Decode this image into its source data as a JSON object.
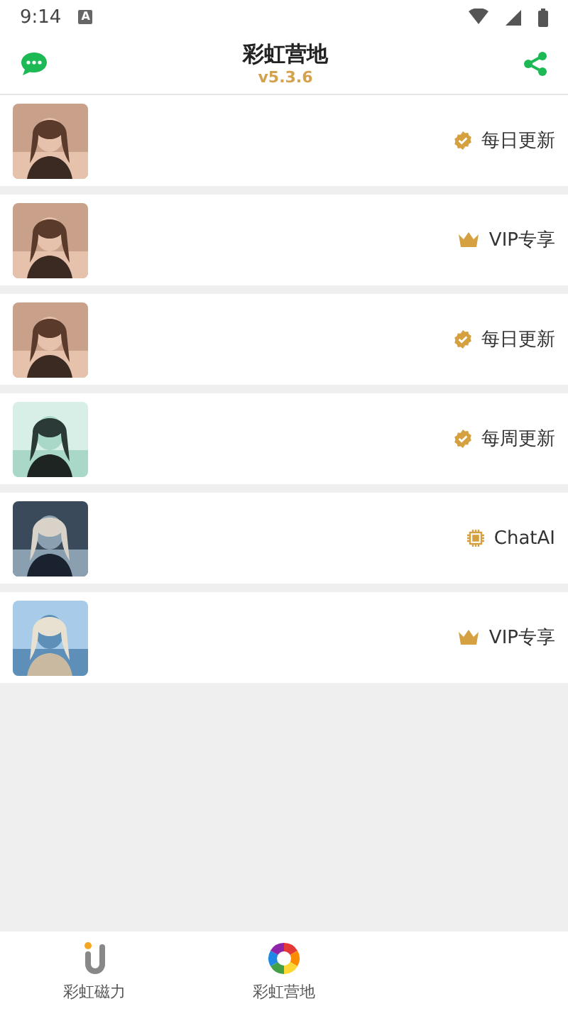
{
  "status_bar": {
    "time": "9:14",
    "notification": "A"
  },
  "header": {
    "title": "彩虹营地",
    "version": "v5.3.6"
  },
  "items": [
    {
      "kind": "check",
      "label": "每日更新"
    },
    {
      "kind": "crown",
      "label": "VIP专享"
    },
    {
      "kind": "check",
      "label": "每日更新"
    },
    {
      "kind": "check",
      "label": "每周更新"
    },
    {
      "kind": "chip",
      "label": "ChatAI"
    },
    {
      "kind": "crown",
      "label": "VIP专享"
    }
  ],
  "bottom_nav": [
    {
      "label": "彩虹磁力",
      "selected": false
    },
    {
      "label": "彩虹营地",
      "selected": false
    }
  ]
}
